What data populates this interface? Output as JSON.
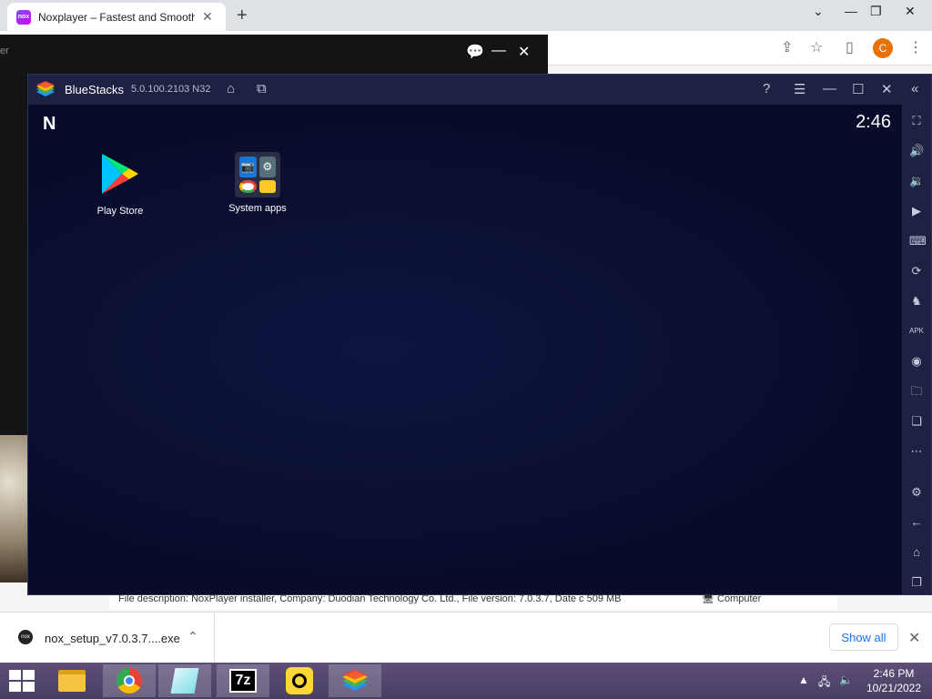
{
  "browser": {
    "tab_title": "Noxplayer – Fastest and Smooth",
    "tab_favicon": "nox",
    "new_tab": "+",
    "profile_initial": "C",
    "accent": "#e8710a"
  },
  "nox": {
    "tail_text": "er"
  },
  "bluestacks": {
    "title": "BlueStacks",
    "version": "5.0.100.2103 N32",
    "clock": "2:46",
    "home_logo": "N",
    "apps": [
      {
        "label": "Play Store"
      },
      {
        "label": "System apps"
      }
    ],
    "bg_color": "#0b0f2e"
  },
  "page_strip": {
    "description": "File description: NoxPlayer installer, Company: Duodian Technology Co. Ltd., File version: 7.0.3.7, Date c 509 MB",
    "computer": "Computer"
  },
  "download": {
    "filename": "nox_setup_v7.0.3.7....exe",
    "icon_label": "nox",
    "show_all": "Show all"
  },
  "taskbar": {
    "time": "2:46 PM",
    "date": "10/21/2022",
    "sevenzip": "7z"
  }
}
